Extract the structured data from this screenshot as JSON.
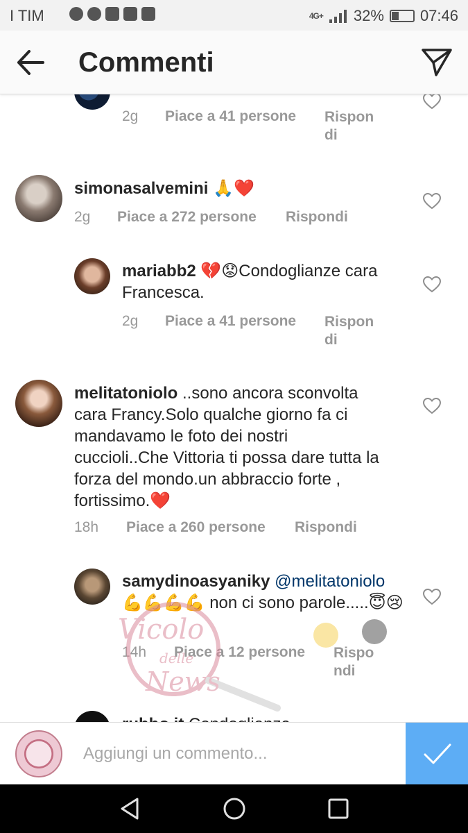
{
  "status_bar": {
    "carrier": "I TIM",
    "network": "4G+",
    "battery": "32%",
    "time": "07:46"
  },
  "header": {
    "title": "Commenti",
    "back_icon": "arrow-left-icon",
    "send_icon": "paper-plane-icon"
  },
  "comments": [
    {
      "id": "partial-top",
      "reply": true,
      "user": "",
      "text": "",
      "time": "2g",
      "likes": "Piace a 41 persone",
      "reply_label": "Rispon di"
    },
    {
      "id": "simonasalvemini",
      "reply": false,
      "user": "simonasalvemini",
      "text": "🙏❤️",
      "time": "2g",
      "likes": "Piace a 272 persone",
      "reply_label": "Rispondi"
    },
    {
      "id": "mariabb2",
      "reply": true,
      "user": "mariabb2",
      "text": "💔😟Condoglianze cara Francesca.",
      "time": "2g",
      "likes": "Piace a 41 persone",
      "reply_label": "Rispon di"
    },
    {
      "id": "melitatoniolo",
      "reply": false,
      "user": "melitatoniolo",
      "text": "..sono ancora sconvolta cara Francy.Solo qualche giorno fa ci mandavamo le foto dei nostri cuccioli..Che Vittoria ti possa dare tutta la forza del mondo.un abbraccio forte , fortissimo.❤️",
      "time": "18h",
      "likes": "Piace a 260 persone",
      "reply_label": "Rispondi"
    },
    {
      "id": "samydinoasyaniky",
      "reply": true,
      "user": "samydinoasyaniky",
      "mention": "@melitatoniolo",
      "text": "💪💪💪💪 non ci sono parole.....😇😢",
      "time": "14h",
      "likes": "Piace a 12 persone",
      "reply_label": "Rispo ndi"
    },
    {
      "id": "partial-bottom",
      "reply": false,
      "user": "rubbo.it",
      "text": "Condoglianze"
    }
  ],
  "composer": {
    "placeholder": "Aggiungi un commento...",
    "submit_icon": "checkmark-icon"
  },
  "watermark": {
    "text_line1": "Vicolo",
    "text_line2": "delle",
    "text_line3": "News"
  },
  "nav": {
    "back_icon": "triangle-back-icon",
    "home_icon": "circle-home-icon",
    "recents_icon": "square-recents-icon"
  },
  "colors": {
    "text": "#262626",
    "meta": "#999999",
    "mention": "#003569",
    "submit": "#5dadf5",
    "heart_outline": "#8e8e8e"
  }
}
